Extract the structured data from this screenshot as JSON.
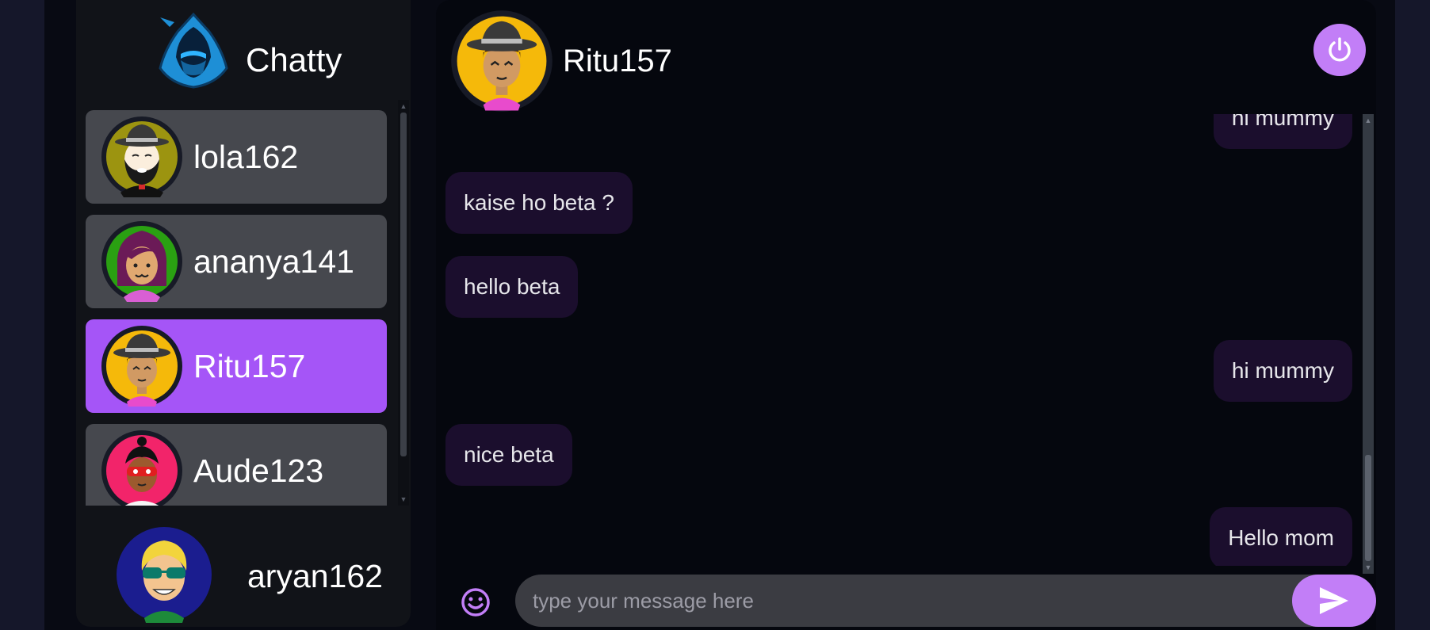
{
  "app": {
    "brand_name": "Chatty"
  },
  "contacts": [
    {
      "name": "lola162",
      "selected": false,
      "avatar": "avatar-bearded-man-hat"
    },
    {
      "name": "ananya141",
      "selected": false,
      "avatar": "avatar-woman-purple-hair"
    },
    {
      "name": "Ritu157",
      "selected": true,
      "avatar": "avatar-hat-woman-yellow"
    },
    {
      "name": "Aude123",
      "selected": false,
      "avatar": "avatar-red-mask-character"
    }
  ],
  "current_user": {
    "name": "aryan162",
    "avatar": "avatar-blonde-sunglasses"
  },
  "chat": {
    "contact_name": "Ritu157",
    "messages": [
      {
        "text": "hi mummy",
        "side": "sent"
      },
      {
        "text": "kaise ho beta ?",
        "side": "received"
      },
      {
        "text": "hello beta",
        "side": "received"
      },
      {
        "text": "hi mummy",
        "side": "sent"
      },
      {
        "text": "nice beta",
        "side": "received"
      },
      {
        "text": "Hello mom",
        "side": "sent"
      }
    ],
    "input_placeholder": "type your message here",
    "input_value": ""
  },
  "icons": {
    "logout": "power-icon",
    "emoji": "smiley-icon",
    "send": "send-icon",
    "logo": "hooded-ninja-logo-icon"
  },
  "colors": {
    "accent": "#a555f7",
    "button_accent": "#c27ef7",
    "contact_bg": "#46484e",
    "bubble_bg": "#1b0e2d",
    "panel_bg": "#05070e",
    "sidebar_bg": "#111318"
  }
}
